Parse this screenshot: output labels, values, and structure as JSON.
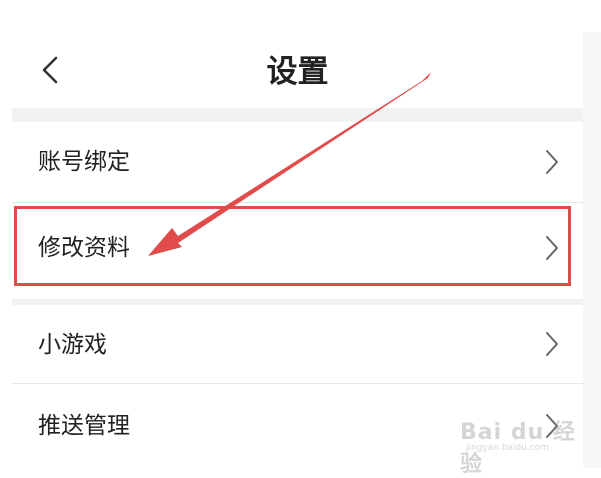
{
  "header": {
    "title": "设置",
    "back_icon": "back-chevron-icon"
  },
  "menu": {
    "items": [
      {
        "label": "账号绑定",
        "icon": "chevron-right-icon",
        "highlighted": false
      },
      {
        "label": "修改资料",
        "icon": "chevron-right-icon",
        "highlighted": true
      },
      {
        "label": "小游戏",
        "icon": "chevron-right-icon",
        "highlighted": false
      },
      {
        "label": "推送管理",
        "icon": "chevron-right-icon",
        "highlighted": false
      }
    ]
  },
  "annotation": {
    "box_color": "#e24b4b",
    "arrow_color": "#e24b4b"
  },
  "watermark": {
    "text": "Bai du 经验",
    "url": "jingyan.baidu.com"
  }
}
